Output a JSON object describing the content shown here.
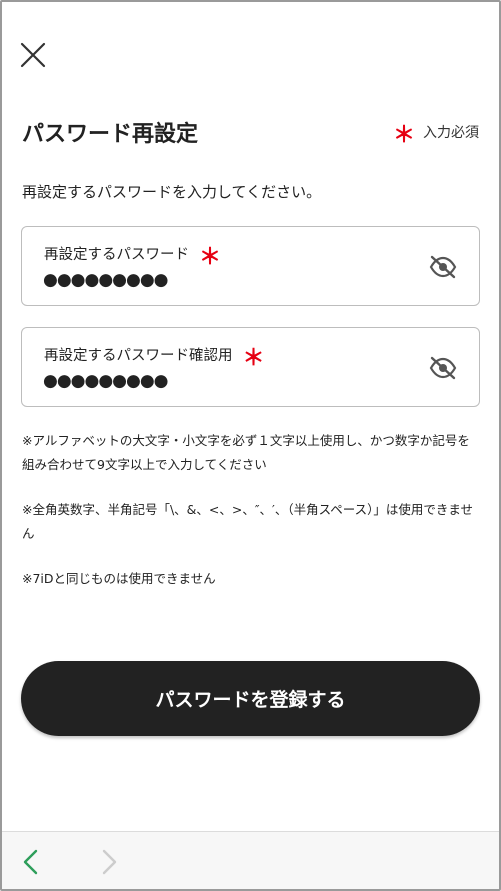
{
  "header": {
    "close_icon": "close-icon",
    "title": "パスワード再設定",
    "required_mark": "＊",
    "required_label": "入力必須"
  },
  "instruction": "再設定するパスワードを入力してください。",
  "fields": [
    {
      "label": "再設定するパスワード",
      "required_mark": "＊",
      "value": "●●●●●●●●●",
      "icon": "eye-slash-icon"
    },
    {
      "label": "再設定するパスワード確認用",
      "required_mark": "＊",
      "value": "●●●●●●●●●",
      "icon": "eye-slash-icon"
    }
  ],
  "notes": [
    "※アルファベットの大文字・小文字を必ず１文字以上使用し、かつ数字か記号を組み合わせて9文字以上で入力してください",
    "※全角英数字、半角記号「\\、&、<、>、″、′、（半角スペース）」は使用できません",
    "※7iDと同じものは使用できません"
  ],
  "submit_label": "パスワードを登録する",
  "bottom_nav": {
    "back_icon": "chevron-left-icon",
    "forward_icon": "chevron-right-icon"
  },
  "colors": {
    "accent_required": "#e60012",
    "button_bg": "#222222",
    "nav_back": "#2e9e5b",
    "nav_forward_disabled": "#cccccc"
  }
}
